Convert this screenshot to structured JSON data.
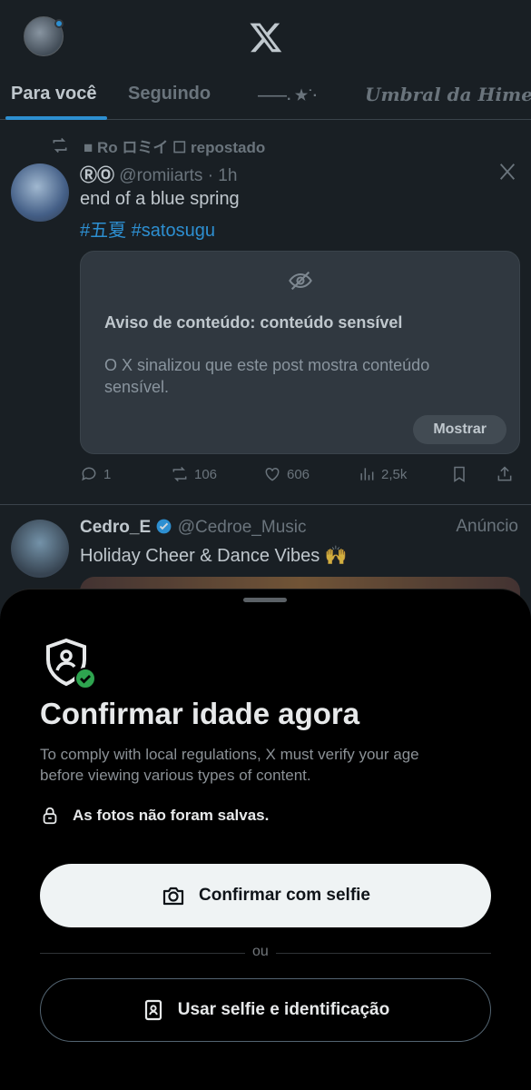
{
  "header": {
    "logo_icon": "x-logo-icon"
  },
  "tabs": [
    {
      "label": "Para você"
    },
    {
      "label": "Seguindo"
    },
    {
      "label": "Umbral da Hime",
      "prefix": "——. ★˙·"
    }
  ],
  "post1": {
    "repost_text": "■ Ro ロミイ ☐ repostado",
    "name": "ⓇⓄ",
    "handle": "@romiiarts · 1h",
    "text": "end of a blue spring",
    "hashtags": "#五夏 #satosugu",
    "warning_title": "Aviso de conteúdo: conteúdo sensível",
    "warning_desc": "O X sinalizou que este post mostra conteúdo sensível.",
    "show_label": "Mostrar",
    "replies": "1",
    "reposts": "106",
    "likes": "606",
    "views": "2,5k"
  },
  "post2": {
    "name": "Cedro_E",
    "handle": "@Cedroe_Music",
    "ad_label": "Anúncio",
    "text": "Holiday Cheer & Dance Vibes 🙌"
  },
  "sheet": {
    "title": "Confirmar idade agora",
    "description": "To comply with local regulations, X must verify your age before viewing various types of content.",
    "notice": "As fotos não foram salvas.",
    "primary_button": "Confirmar com selfie",
    "or_text": "ou",
    "secondary_button": "Usar selfie e identificação"
  },
  "colors": {
    "accent": "#1d9bf0",
    "verified_check": "#2ea44f"
  }
}
